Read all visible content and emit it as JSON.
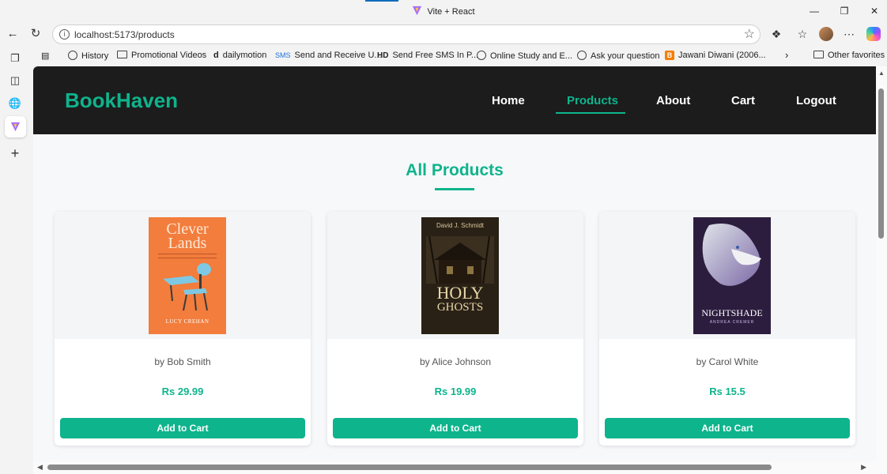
{
  "browser": {
    "tab_title": "Vite + React",
    "url": "localhost:5173/products",
    "favorites": [
      {
        "label": "History",
        "icon": "globe-icon"
      },
      {
        "label": "Promotional Videos",
        "icon": "folder-icon"
      },
      {
        "label": "dailymotion",
        "icon": "dailymotion-icon"
      },
      {
        "label": "Send and Receive U...",
        "icon": "sms-icon"
      },
      {
        "label": "Send Free SMS In P...",
        "icon": "hd-icon"
      },
      {
        "label": "Online Study and E...",
        "icon": "globe-icon"
      },
      {
        "label": "Ask your question",
        "icon": "globe-icon"
      },
      {
        "label": "Jawani Diwani (2006...",
        "icon": "blogger-icon"
      }
    ],
    "other_favorites": "Other favorites"
  },
  "app": {
    "brand": "BookHaven",
    "nav": [
      "Home",
      "Products",
      "About",
      "Cart",
      "Logout"
    ],
    "active_nav": "Products",
    "accent_color": "#0eb48c",
    "page_title": "All Products"
  },
  "products": [
    {
      "author": "by Bob Smith",
      "price": "Rs 29.99",
      "button": "Add to Cart",
      "cover": {
        "title_line1": "Clever",
        "title_line2": "Lands",
        "author": "LUCY CREHAN"
      }
    },
    {
      "author": "by Alice Johnson",
      "price": "Rs 19.99",
      "button": "Add to Cart",
      "cover": {
        "author": "David J. Schmidt",
        "title_line1": "HOLY",
        "title_line2": "GHOSTS"
      }
    },
    {
      "author": "by Carol White",
      "price": "Rs 15.5",
      "button": "Add to Cart",
      "cover": {
        "title_line1": "NIGHTSHADE",
        "author": "ANDREA CREMER"
      }
    }
  ]
}
